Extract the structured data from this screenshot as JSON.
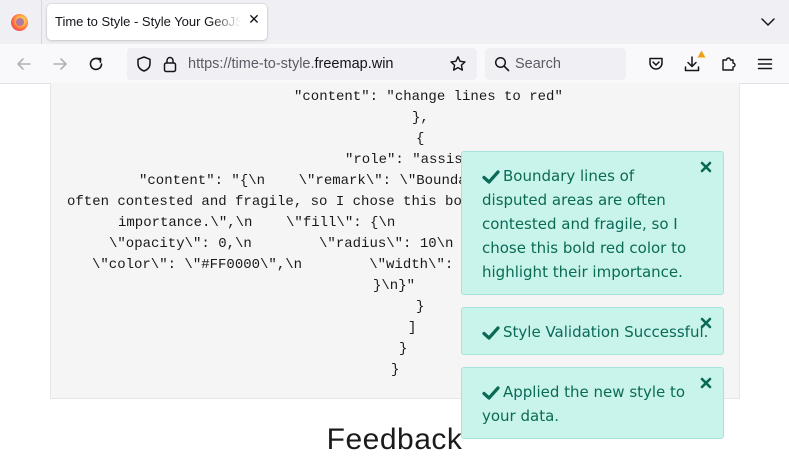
{
  "browser": {
    "tab": {
      "title": "Time to Style - Style Your GeoJSON",
      "close_glyph": "✕"
    },
    "url": {
      "prefix": "https://time-to-style.",
      "host": "freemap.win"
    },
    "search": {
      "placeholder": "Search"
    }
  },
  "page": {
    "code_lines": [
      "\"content\": \"change lines to red\"",
      "},",
      "{",
      "\"role\": \"assis",
      "\"content\": \"{\\n    \\\"remark\\\": \\\"Bounda",
      "often contested and fragile, so I chose this bo",
      "importance.\\\",\\n    \\\"fill\\\": {\\n",
      "\\\"opacity\\\": 0,\\n        \\\"radius\\\": 10\\n",
      "\\\"color\\\": \\\"#FF0000\\\",\\n        \\\"width\\\":",
      "}\\n}\"",
      "}",
      "]",
      "}",
      "}"
    ],
    "feedback_heading": "Feedback"
  },
  "toasts": [
    {
      "message": "Boundary lines of disputed areas are often contested and fragile, so I chose this bold red color to highlight their importance."
    },
    {
      "message": "Style Validation Successful."
    },
    {
      "message": "Applied the new style to your data."
    }
  ],
  "colors": {
    "toast_bg": "#c9f4ec",
    "toast_text": "#0b6a56",
    "download_warning": "#f0a018"
  }
}
